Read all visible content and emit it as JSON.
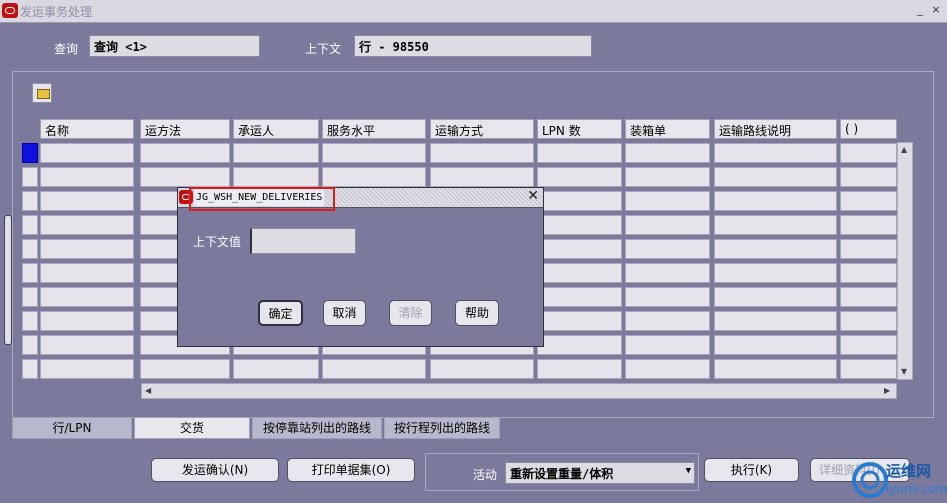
{
  "window": {
    "title": "发运事务处理",
    "controls": [
      "_",
      "×"
    ]
  },
  "header": {
    "query_label": "查询",
    "query_value": "查询 <1>",
    "context_label": "上下文",
    "context_value": "行 - 98550"
  },
  "grid": {
    "columns": [
      "名称",
      "运方法",
      "承运人",
      "服务水平",
      "运输方式",
      "LPN 数",
      "装箱单",
      "运输路线说明",
      "( )"
    ],
    "row_count": 10
  },
  "tabs": [
    {
      "label": "行/LPN",
      "active": false
    },
    {
      "label": "交货",
      "active": true
    },
    {
      "label": "按停靠站列出的路线",
      "active": false
    },
    {
      "label": "按行程列出的路线",
      "active": false
    }
  ],
  "footer": {
    "confirm_label": "发运确认(N)",
    "print_label": "打印单据集(O)",
    "action_label": "活动",
    "action_value": "重新设置重量/体积",
    "execute_label": "执行(K)",
    "detail_label": "详细资料(I)"
  },
  "dialog": {
    "title": "JG_WSH_NEW_DELIVERIES",
    "field_label": "上下文值",
    "field_value": "",
    "ok_label": "确定",
    "cancel_label": "取消",
    "clear_label": "清除",
    "help_label": "帮助"
  },
  "watermark": {
    "text": "运维网",
    "sub": "iyunv.com"
  },
  "colors": {
    "background": "#7c7a9c",
    "accent_red": "#e01818",
    "selected_row": "#1010e0"
  }
}
